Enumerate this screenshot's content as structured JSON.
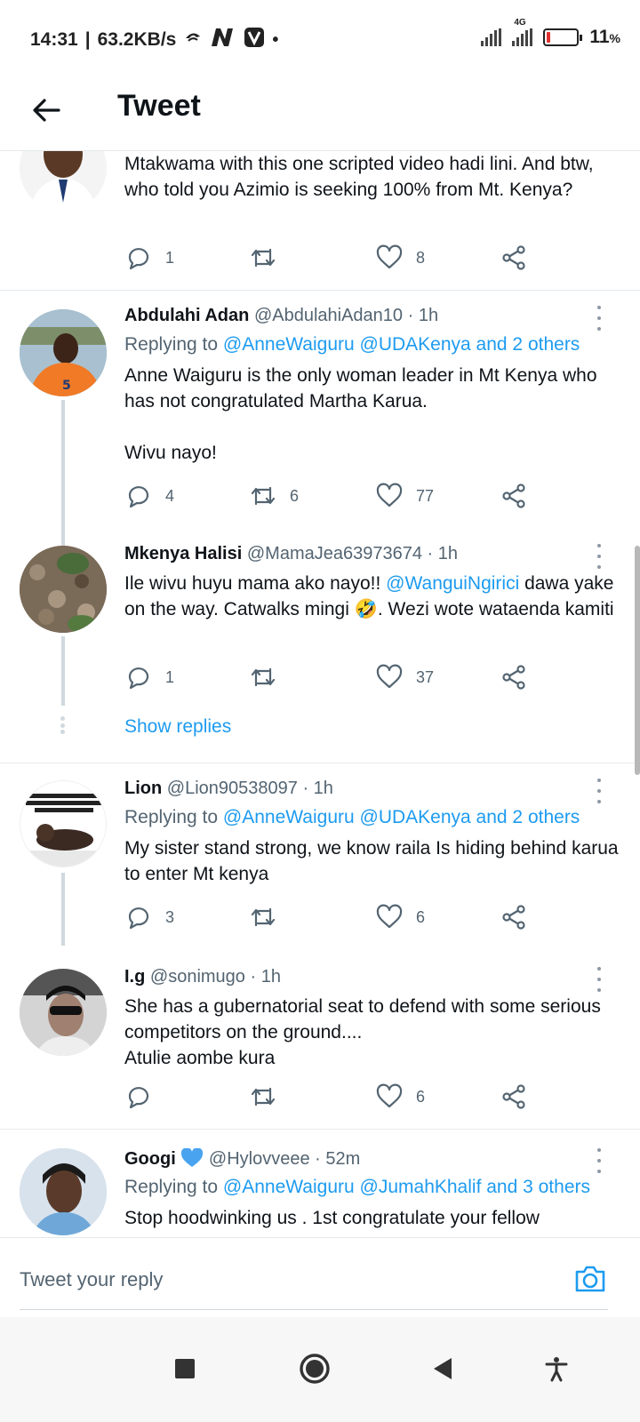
{
  "status_bar": {
    "time": "14:31",
    "separator": "|",
    "speed": "63.2KB/s",
    "network_type": "4G",
    "battery_percent": "11",
    "battery_unit": "%",
    "battery_level": 0.11,
    "battery_color": "#e0322f"
  },
  "header": {
    "title": "Tweet",
    "back_icon": "back-arrow-icon"
  },
  "colors": {
    "accent": "#1d9bf0",
    "text": "#0f1419",
    "muted": "#536471"
  },
  "tweets": [
    {
      "text": "Mtakwama with this one scripted video hadi lini. And btw, who told you Azimio is seeking 100% from Mt. Kenya?",
      "reply_count": "1",
      "retweet_count": "",
      "like_count": "8"
    },
    {
      "name": "Abdulahi Adan",
      "handle": "@AbdulahiAdan10",
      "time": "· 1h",
      "replying_prefix": "Replying to",
      "replying_to": "@AnneWaiguru @UDAKenya and 2 others",
      "text": "Anne Waiguru is the only woman leader in Mt Kenya who has not congratulated Martha Karua.\n\nWivu nayo!",
      "reply_count": "4",
      "retweet_count": "6",
      "like_count": "77"
    },
    {
      "name": "Mkenya Halisi",
      "handle": "@MamaJea63973674",
      "time": "· 1h",
      "text_before": "Ile wivu huyu mama ako nayo!! ",
      "mention": "@WanguiNgirici",
      "text_after": " dawa yake on the way. Catwalks mingi 🤣. Wezi wote wataenda kamiti",
      "reply_count": "1",
      "retweet_count": "",
      "like_count": "37"
    },
    {
      "name": "Lion",
      "handle": "@Lion90538097",
      "time": "· 1h",
      "replying_prefix": "Replying to",
      "replying_to": "@AnneWaiguru @UDAKenya and 2 others",
      "text": "My sister stand strong, we know raila Is hiding behind karua to enter Mt kenya",
      "reply_count": "3",
      "retweet_count": "",
      "like_count": "6"
    },
    {
      "name": "I.g",
      "handle": "@sonimugo",
      "time": "· 1h",
      "text": "She has a gubernatorial seat to defend   with some serious competitors on the ground....\nAtulie aombe kura",
      "reply_count": "",
      "retweet_count": "",
      "like_count": "6"
    },
    {
      "name": "Googi",
      "handle": "@Hylovveee",
      "time": "· 52m",
      "replying_prefix": "Replying to",
      "replying_to": "@AnneWaiguru @JumahKhalif and 3 others",
      "text": "Stop hoodwinking us . 1st congratulate your fellow"
    }
  ],
  "show_replies": "Show replies",
  "reply_bar": {
    "placeholder": "Tweet your reply"
  }
}
